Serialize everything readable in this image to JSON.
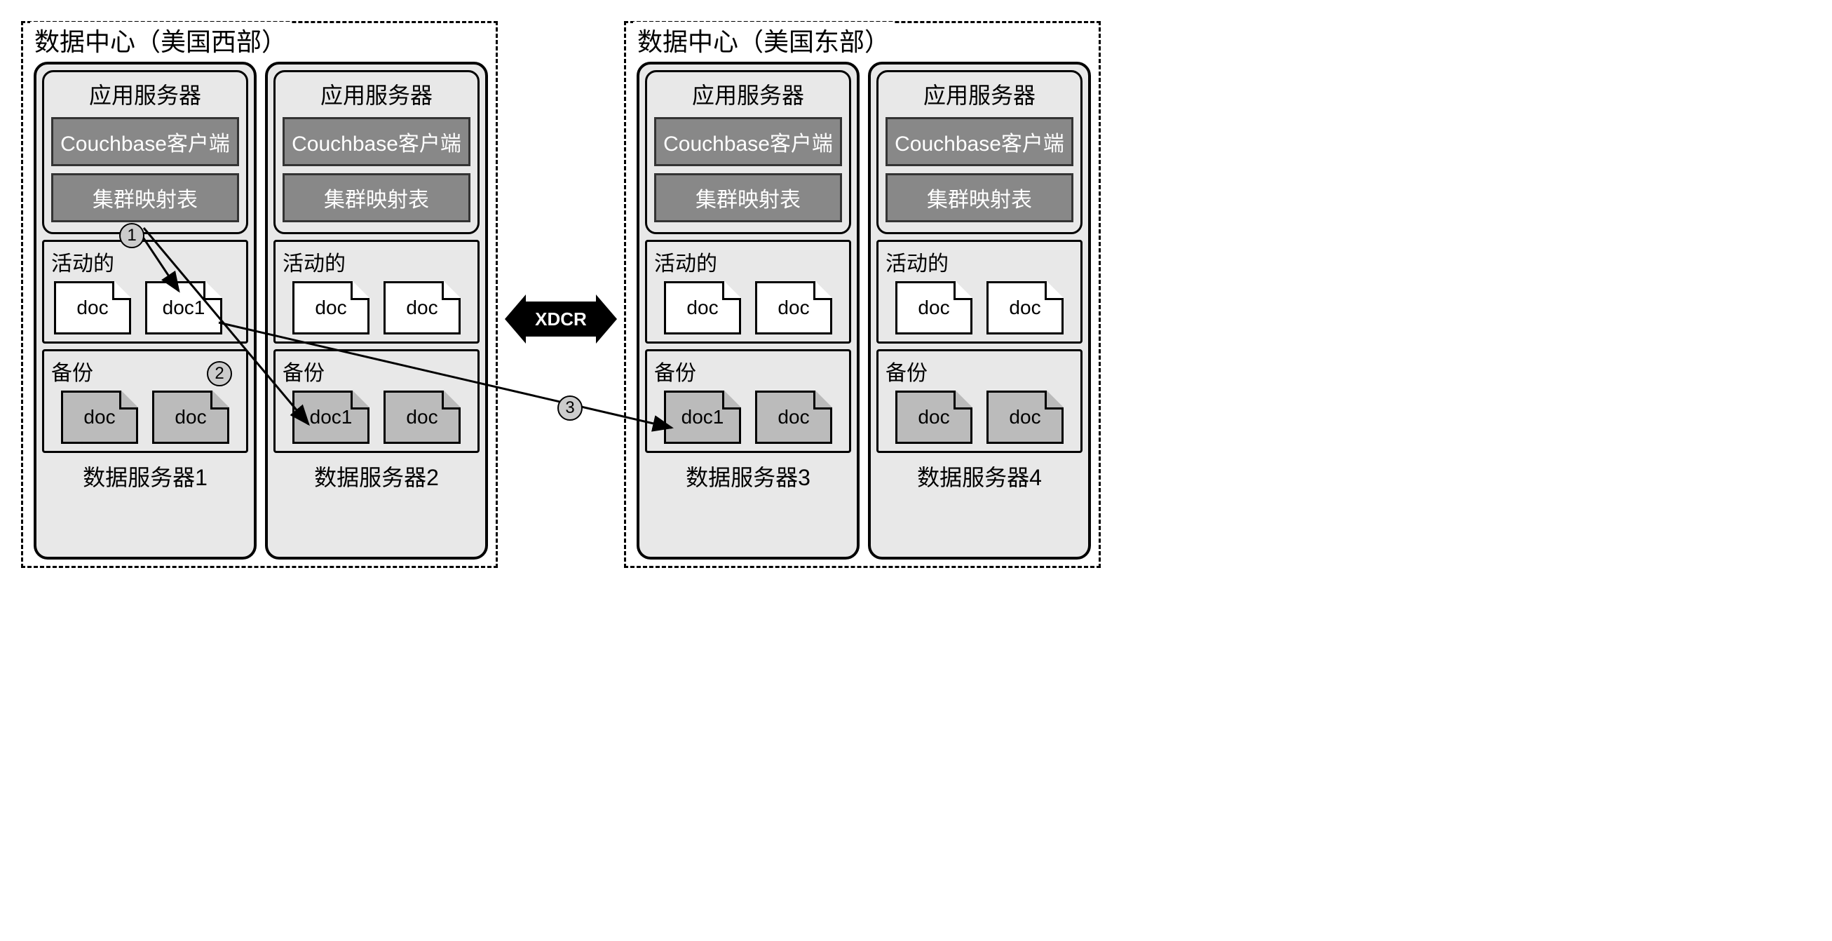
{
  "datacenters": {
    "west": {
      "title": "数据中心（美国西部）",
      "servers": [
        {
          "app_title": "应用服务器",
          "client": "Couchbase客户端",
          "cluster_map": "集群映射表",
          "active_label": "活动的",
          "active_docs": [
            "doc",
            "doc1"
          ],
          "replica_label": "备份",
          "replica_docs": [
            "doc",
            "doc"
          ],
          "server_label": "数据服务器1"
        },
        {
          "app_title": "应用服务器",
          "client": "Couchbase客户端",
          "cluster_map": "集群映射表",
          "active_label": "活动的",
          "active_docs": [
            "doc",
            "doc"
          ],
          "replica_label": "备份",
          "replica_docs": [
            "doc1",
            "doc"
          ],
          "server_label": "数据服务器2"
        }
      ]
    },
    "east": {
      "title": "数据中心（美国东部）",
      "servers": [
        {
          "app_title": "应用服务器",
          "client": "Couchbase客户端",
          "cluster_map": "集群映射表",
          "active_label": "活动的",
          "active_docs": [
            "doc",
            "doc"
          ],
          "replica_label": "备份",
          "replica_docs": [
            "doc1",
            "doc"
          ],
          "server_label": "数据服务器3"
        },
        {
          "app_title": "应用服务器",
          "client": "Couchbase客户端",
          "cluster_map": "集群映射表",
          "active_label": "活动的",
          "active_docs": [
            "doc",
            "doc"
          ],
          "replica_label": "备份",
          "replica_docs": [
            "doc",
            "doc"
          ],
          "server_label": "数据服务器4"
        }
      ]
    }
  },
  "xdcr_label": "XDCR",
  "badges": {
    "one": "1",
    "two": "2",
    "three": "3"
  }
}
